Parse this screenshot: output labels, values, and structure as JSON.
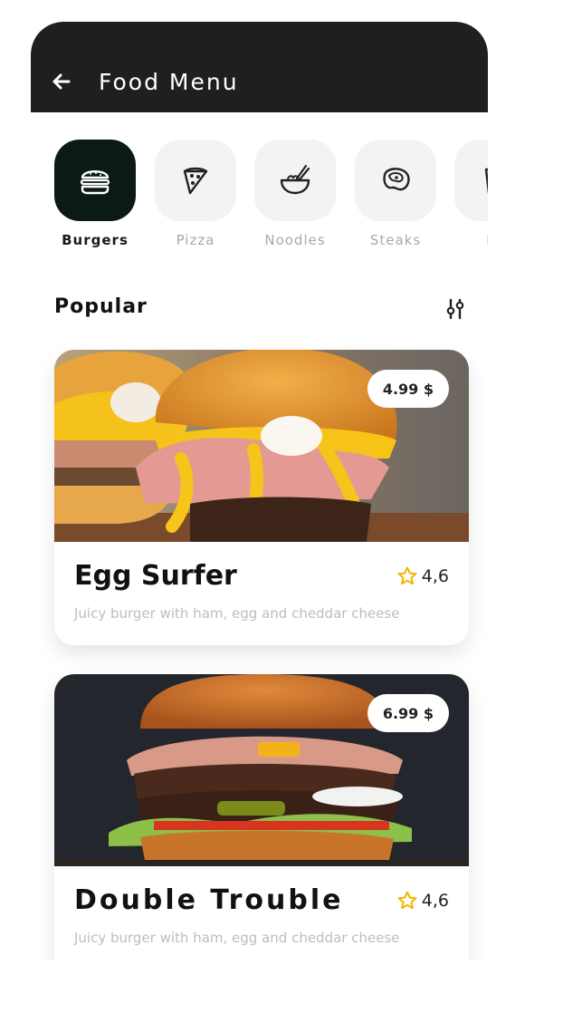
{
  "appbar": {
    "title": "Food Menu",
    "back_icon": "arrow-left-icon"
  },
  "categories": [
    {
      "label": "Burgers",
      "icon": "burger-icon",
      "active": true
    },
    {
      "label": "Pizza",
      "icon": "pizza-slice-icon",
      "active": false
    },
    {
      "label": "Noodles",
      "icon": "noodle-bowl-icon",
      "active": false
    },
    {
      "label": "Steaks",
      "icon": "steak-icon",
      "active": false
    },
    {
      "label": "Dr",
      "icon": "drink-icon",
      "active": false
    }
  ],
  "section": {
    "title": "Popular",
    "filter_icon": "filter-sliders-icon"
  },
  "items": [
    {
      "name": "Egg Surfer",
      "price": "4.99 $",
      "rating": "4,6",
      "description": "Juicy burger with ham, egg and cheddar cheese"
    },
    {
      "name": "Double Trouble",
      "price": "6.99 $",
      "rating": "4,6",
      "description": "Juicy burger with ham, egg and cheddar cheese"
    }
  ],
  "colors": {
    "appbar_bg": "#1f1f1f",
    "active_category": "#0b1a12",
    "inactive_tile": "#f3f3f3",
    "star": "#f5b301"
  }
}
